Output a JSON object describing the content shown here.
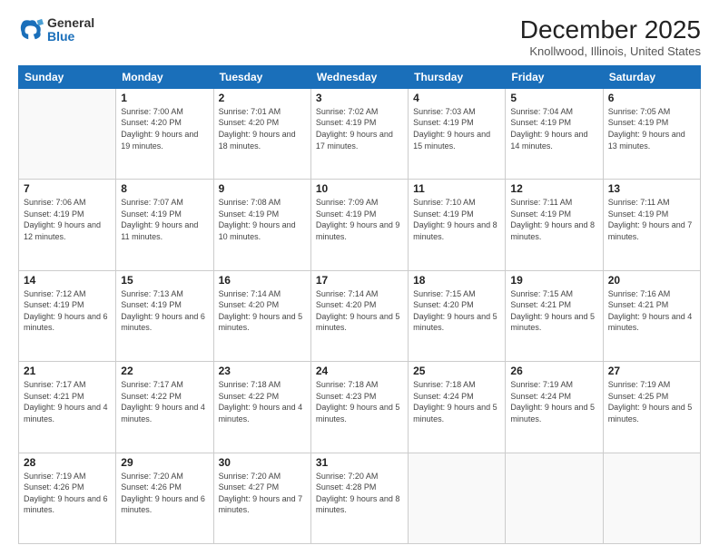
{
  "logo": {
    "general": "General",
    "blue": "Blue"
  },
  "header": {
    "title": "December 2025",
    "subtitle": "Knollwood, Illinois, United States"
  },
  "weekdays": [
    "Sunday",
    "Monday",
    "Tuesday",
    "Wednesday",
    "Thursday",
    "Friday",
    "Saturday"
  ],
  "weeks": [
    [
      {
        "day": null,
        "sunrise": null,
        "sunset": null,
        "daylight": null
      },
      {
        "day": "1",
        "sunrise": "Sunrise: 7:00 AM",
        "sunset": "Sunset: 4:20 PM",
        "daylight": "Daylight: 9 hours and 19 minutes."
      },
      {
        "day": "2",
        "sunrise": "Sunrise: 7:01 AM",
        "sunset": "Sunset: 4:20 PM",
        "daylight": "Daylight: 9 hours and 18 minutes."
      },
      {
        "day": "3",
        "sunrise": "Sunrise: 7:02 AM",
        "sunset": "Sunset: 4:19 PM",
        "daylight": "Daylight: 9 hours and 17 minutes."
      },
      {
        "day": "4",
        "sunrise": "Sunrise: 7:03 AM",
        "sunset": "Sunset: 4:19 PM",
        "daylight": "Daylight: 9 hours and 15 minutes."
      },
      {
        "day": "5",
        "sunrise": "Sunrise: 7:04 AM",
        "sunset": "Sunset: 4:19 PM",
        "daylight": "Daylight: 9 hours and 14 minutes."
      },
      {
        "day": "6",
        "sunrise": "Sunrise: 7:05 AM",
        "sunset": "Sunset: 4:19 PM",
        "daylight": "Daylight: 9 hours and 13 minutes."
      }
    ],
    [
      {
        "day": "7",
        "sunrise": "Sunrise: 7:06 AM",
        "sunset": "Sunset: 4:19 PM",
        "daylight": "Daylight: 9 hours and 12 minutes."
      },
      {
        "day": "8",
        "sunrise": "Sunrise: 7:07 AM",
        "sunset": "Sunset: 4:19 PM",
        "daylight": "Daylight: 9 hours and 11 minutes."
      },
      {
        "day": "9",
        "sunrise": "Sunrise: 7:08 AM",
        "sunset": "Sunset: 4:19 PM",
        "daylight": "Daylight: 9 hours and 10 minutes."
      },
      {
        "day": "10",
        "sunrise": "Sunrise: 7:09 AM",
        "sunset": "Sunset: 4:19 PM",
        "daylight": "Daylight: 9 hours and 9 minutes."
      },
      {
        "day": "11",
        "sunrise": "Sunrise: 7:10 AM",
        "sunset": "Sunset: 4:19 PM",
        "daylight": "Daylight: 9 hours and 8 minutes."
      },
      {
        "day": "12",
        "sunrise": "Sunrise: 7:11 AM",
        "sunset": "Sunset: 4:19 PM",
        "daylight": "Daylight: 9 hours and 8 minutes."
      },
      {
        "day": "13",
        "sunrise": "Sunrise: 7:11 AM",
        "sunset": "Sunset: 4:19 PM",
        "daylight": "Daylight: 9 hours and 7 minutes."
      }
    ],
    [
      {
        "day": "14",
        "sunrise": "Sunrise: 7:12 AM",
        "sunset": "Sunset: 4:19 PM",
        "daylight": "Daylight: 9 hours and 6 minutes."
      },
      {
        "day": "15",
        "sunrise": "Sunrise: 7:13 AM",
        "sunset": "Sunset: 4:19 PM",
        "daylight": "Daylight: 9 hours and 6 minutes."
      },
      {
        "day": "16",
        "sunrise": "Sunrise: 7:14 AM",
        "sunset": "Sunset: 4:20 PM",
        "daylight": "Daylight: 9 hours and 5 minutes."
      },
      {
        "day": "17",
        "sunrise": "Sunrise: 7:14 AM",
        "sunset": "Sunset: 4:20 PM",
        "daylight": "Daylight: 9 hours and 5 minutes."
      },
      {
        "day": "18",
        "sunrise": "Sunrise: 7:15 AM",
        "sunset": "Sunset: 4:20 PM",
        "daylight": "Daylight: 9 hours and 5 minutes."
      },
      {
        "day": "19",
        "sunrise": "Sunrise: 7:15 AM",
        "sunset": "Sunset: 4:21 PM",
        "daylight": "Daylight: 9 hours and 5 minutes."
      },
      {
        "day": "20",
        "sunrise": "Sunrise: 7:16 AM",
        "sunset": "Sunset: 4:21 PM",
        "daylight": "Daylight: 9 hours and 4 minutes."
      }
    ],
    [
      {
        "day": "21",
        "sunrise": "Sunrise: 7:17 AM",
        "sunset": "Sunset: 4:21 PM",
        "daylight": "Daylight: 9 hours and 4 minutes."
      },
      {
        "day": "22",
        "sunrise": "Sunrise: 7:17 AM",
        "sunset": "Sunset: 4:22 PM",
        "daylight": "Daylight: 9 hours and 4 minutes."
      },
      {
        "day": "23",
        "sunrise": "Sunrise: 7:18 AM",
        "sunset": "Sunset: 4:22 PM",
        "daylight": "Daylight: 9 hours and 4 minutes."
      },
      {
        "day": "24",
        "sunrise": "Sunrise: 7:18 AM",
        "sunset": "Sunset: 4:23 PM",
        "daylight": "Daylight: 9 hours and 5 minutes."
      },
      {
        "day": "25",
        "sunrise": "Sunrise: 7:18 AM",
        "sunset": "Sunset: 4:24 PM",
        "daylight": "Daylight: 9 hours and 5 minutes."
      },
      {
        "day": "26",
        "sunrise": "Sunrise: 7:19 AM",
        "sunset": "Sunset: 4:24 PM",
        "daylight": "Daylight: 9 hours and 5 minutes."
      },
      {
        "day": "27",
        "sunrise": "Sunrise: 7:19 AM",
        "sunset": "Sunset: 4:25 PM",
        "daylight": "Daylight: 9 hours and 5 minutes."
      }
    ],
    [
      {
        "day": "28",
        "sunrise": "Sunrise: 7:19 AM",
        "sunset": "Sunset: 4:26 PM",
        "daylight": "Daylight: 9 hours and 6 minutes."
      },
      {
        "day": "29",
        "sunrise": "Sunrise: 7:20 AM",
        "sunset": "Sunset: 4:26 PM",
        "daylight": "Daylight: 9 hours and 6 minutes."
      },
      {
        "day": "30",
        "sunrise": "Sunrise: 7:20 AM",
        "sunset": "Sunset: 4:27 PM",
        "daylight": "Daylight: 9 hours and 7 minutes."
      },
      {
        "day": "31",
        "sunrise": "Sunrise: 7:20 AM",
        "sunset": "Sunset: 4:28 PM",
        "daylight": "Daylight: 9 hours and 8 minutes."
      },
      {
        "day": null,
        "sunrise": null,
        "sunset": null,
        "daylight": null
      },
      {
        "day": null,
        "sunrise": null,
        "sunset": null,
        "daylight": null
      },
      {
        "day": null,
        "sunrise": null,
        "sunset": null,
        "daylight": null
      }
    ]
  ]
}
